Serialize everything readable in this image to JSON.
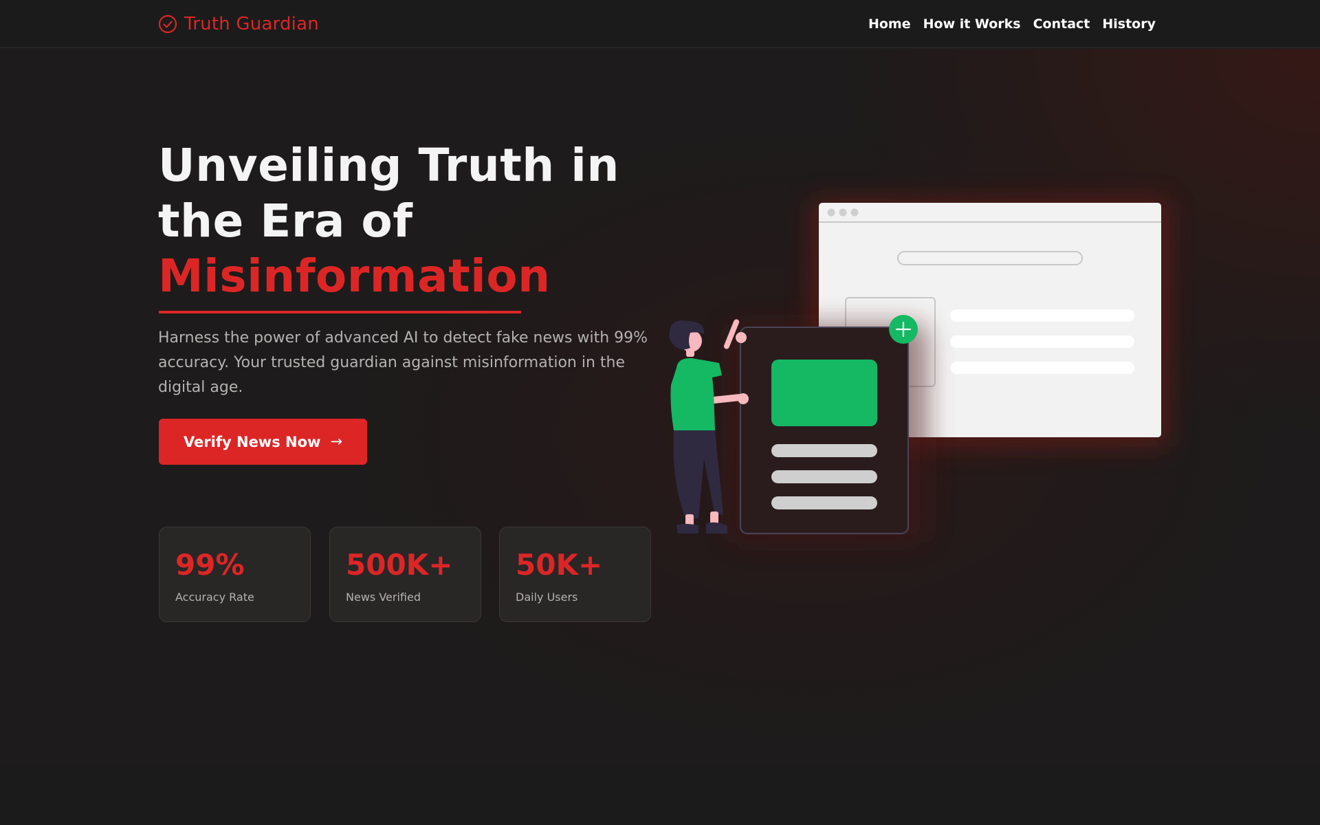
{
  "header": {
    "brand": "Truth Guardian",
    "brand_icon": "check-circle-icon",
    "nav": [
      "Home",
      "How it Works",
      "Contact",
      "History"
    ]
  },
  "hero": {
    "title_line1": "Unveiling Truth in",
    "title_line2": "the Era of",
    "title_highlight": "Misinformation",
    "subtitle": "Harness the power of advanced AI to detect fake news with 99% accuracy. Your trusted guardian against misinformation in the digital age.",
    "cta_label": "Verify News Now",
    "cta_icon": "arrow-right-icon"
  },
  "stats": [
    {
      "value": "99%",
      "label": "Accuracy Rate"
    },
    {
      "value": "500K+",
      "label": "News Verified"
    },
    {
      "value": "50K+",
      "label": "Daily Users"
    }
  ],
  "colors": {
    "accent": "#dc2626",
    "background": "#1b1b1b",
    "success": "#15b863"
  }
}
